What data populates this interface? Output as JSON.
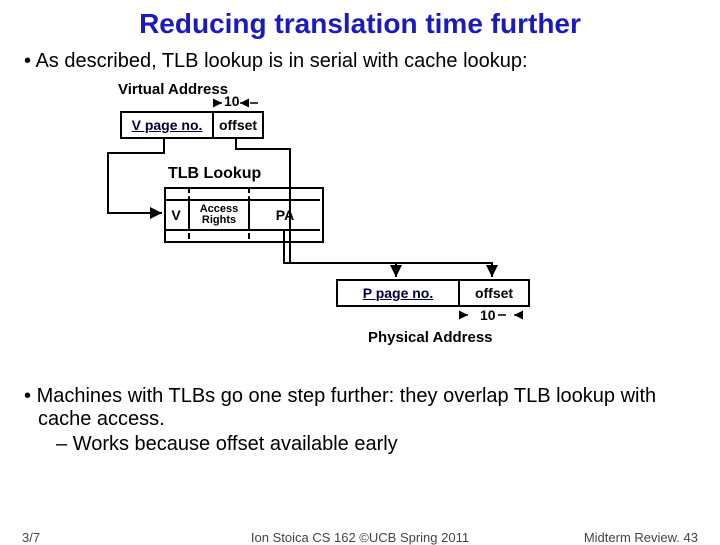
{
  "slide": {
    "title": "Reducing translation time further",
    "bullets": [
      "As described, TLB lookup is in serial with cache lookup:",
      "Machines with TLBs go one step further: they overlap TLB lookup with cache access."
    ],
    "sub_bullet": "Works because offset available early"
  },
  "diagram": {
    "virtual_address_label": "Virtual Address",
    "v_page_no": "V page no.",
    "offset_top": "offset",
    "bits_top": "10",
    "tlb_lookup": "TLB Lookup",
    "tlb_v": "V",
    "tlb_access": "Access",
    "tlb_rights": "Rights",
    "tlb_pa": "PA",
    "p_page_no": "P page no.",
    "offset_bot": "offset",
    "bits_bot": "10",
    "physical_address_label": "Physical Address"
  },
  "footer": {
    "left": "3/7",
    "center": "Ion Stoica CS 162 ©UCB Spring 2011",
    "right": "Midterm Review. 43"
  }
}
